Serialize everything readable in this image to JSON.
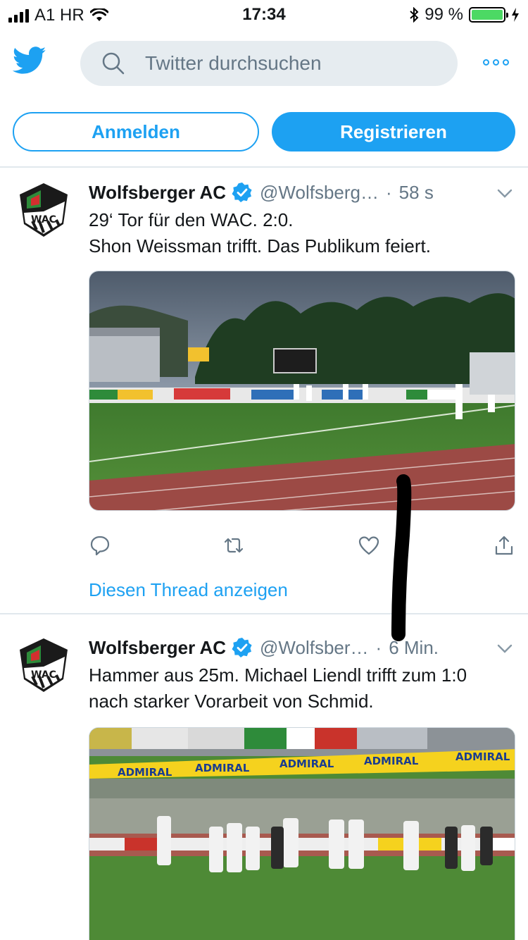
{
  "status_bar": {
    "carrier": "A1 HR",
    "time": "17:34",
    "battery_percent": "99 %",
    "battery_level": 0.99,
    "icons": [
      "signal-icon",
      "wifi-icon",
      "bluetooth-icon",
      "battery-icon",
      "charging-icon"
    ]
  },
  "header": {
    "search_placeholder": "Twitter durchsuchen",
    "icons": [
      "twitter-bird-icon",
      "search-icon",
      "more-icon"
    ]
  },
  "auth": {
    "login_label": "Anmelden",
    "register_label": "Registrieren"
  },
  "colors": {
    "brand": "#1da1f2",
    "text": "#14171a",
    "secondary": "#657786",
    "divider": "#e1e8ed"
  },
  "tweets": [
    {
      "name": "Wolfsberger AC",
      "handle": "@Wolfsberg…",
      "dot": "·",
      "time": "58 s",
      "line1": "29‘ Tor für den WAC. 2:0.",
      "line2": "Shon Weissman trifft. Das Publikum feiert.",
      "thread_link": "Diesen Thread anzeigen",
      "media": "stadium-photo"
    },
    {
      "name": "Wolfsberger AC",
      "handle": "@Wolfsber…",
      "dot": "·",
      "time": "6 Min.",
      "line1": "Hammer aus 25m. Michael Liendl trifft zum 1:0",
      "line2": "nach starker Vorarbeit von Schmid.",
      "media": "team-celebration-photo",
      "banner_text": "ADMIRAL"
    }
  ]
}
